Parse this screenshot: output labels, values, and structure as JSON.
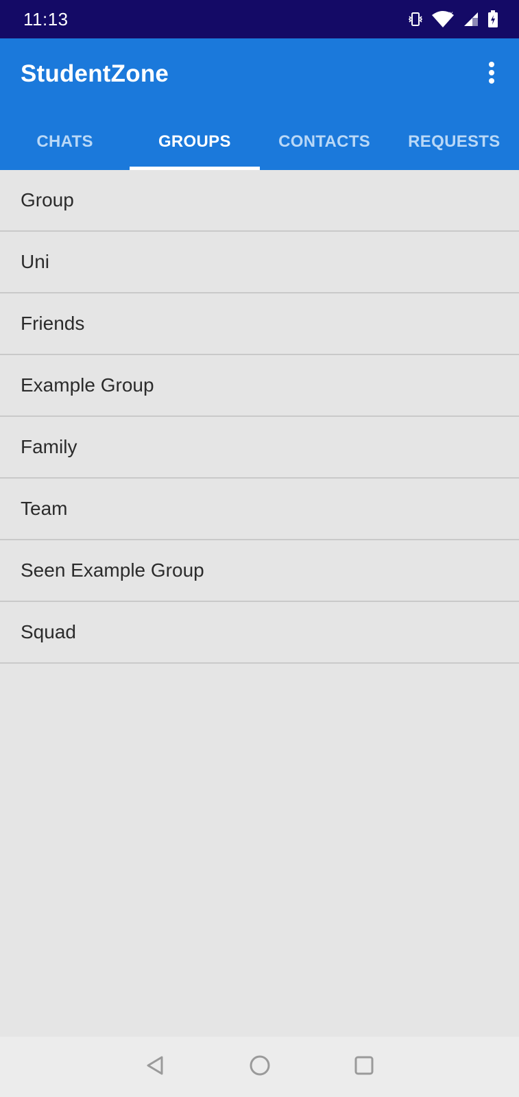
{
  "status_bar": {
    "time": "11:13",
    "icons": [
      "vibrate-icon",
      "wifi-icon",
      "signal-icon",
      "battery-charging-icon"
    ]
  },
  "app_bar": {
    "title": "StudentZone",
    "overflow_icon": "more-vert-icon",
    "color": "#1b79db"
  },
  "tabs": [
    {
      "label": "CHATS",
      "active": false
    },
    {
      "label": "GROUPS",
      "active": true
    },
    {
      "label": "CONTACTS",
      "active": false
    },
    {
      "label": "REQUESTS",
      "active": false
    }
  ],
  "groups": [
    {
      "name": "Group"
    },
    {
      "name": "Uni"
    },
    {
      "name": "Friends"
    },
    {
      "name": "Example Group"
    },
    {
      "name": "Family"
    },
    {
      "name": "Team"
    },
    {
      "name": "Seen Example Group"
    },
    {
      "name": "Squad"
    }
  ],
  "nav_bar": {
    "icons": [
      "back-icon",
      "home-icon",
      "recents-icon"
    ]
  },
  "colors": {
    "status_bar": "#140a66",
    "background": "#e5e5e5",
    "tab_inactive": "#b9d8f7",
    "tab_active": "#ffffff"
  }
}
